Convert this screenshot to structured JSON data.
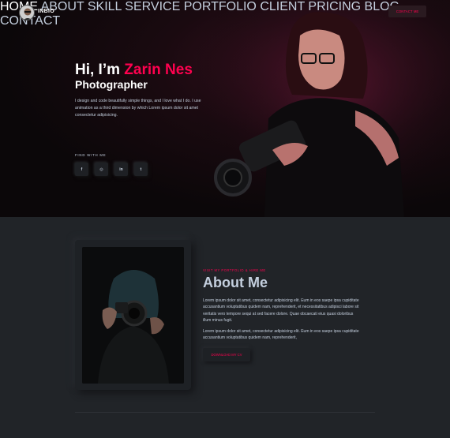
{
  "brand": {
    "name": "INBIO",
    "accent": "#ff014f"
  },
  "nav": {
    "items": [
      "HOME",
      "ABOUT",
      "SKILL",
      "SERVICE",
      "PORTFOLIO",
      "CLIENT",
      "PRICING",
      "BLOG",
      "CONTACT"
    ],
    "contact_button": "CONTACT ME"
  },
  "hero": {
    "greeting": "Hi, I’m ",
    "name": "Zarin Nes",
    "role": "Photographer",
    "intro": "I design and code beautifully simple things, and I love what I do. I use animation as a third dimension by which Lorem ipsum dolor sit amet consectetur adipisicing.",
    "find_label": "FIND WITH ME",
    "socials": [
      {
        "icon": "facebook-icon",
        "glyph": "f"
      },
      {
        "icon": "instagram-icon",
        "glyph": "◎"
      },
      {
        "icon": "linkedin-icon",
        "glyph": "in"
      },
      {
        "icon": "twitter-icon",
        "glyph": "t"
      }
    ]
  },
  "about": {
    "kicker": "VISIT MY PORTFOLIO & HIRE ME",
    "title": "About Me",
    "paragraph1": "Lorem ipsum dolor sit amet, consectetur adipisicing elit. Eum in eos saepe ipsa cupiditate accusantium voluptatibus quidem nam, reprehenderit, et necessitatibus adipisci labore sit veritatis vero tempore sequi at sed facere dolore. Quae obcaecati eius quasi doloribus illum minus fugit.",
    "paragraph2": "Lorem ipsum dolor sit amet, consectetur adipisicing elit. Eum in eos saepe ipsa cupiditate accusantium voluptatibus quidem nam, reprehenderit,",
    "cv_button": "DOWNLOAD MY CV"
  }
}
